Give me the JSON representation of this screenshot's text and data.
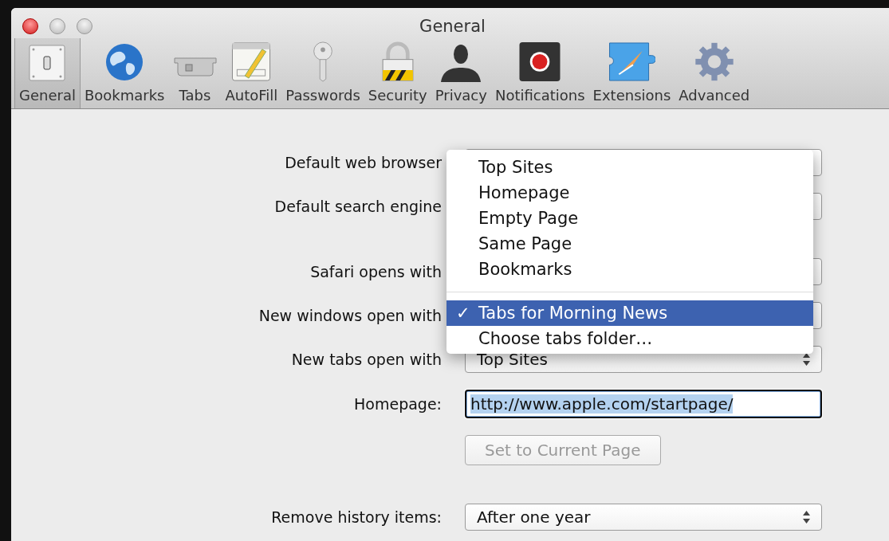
{
  "window": {
    "title": "General"
  },
  "toolbar": [
    {
      "label": "General",
      "selected": true
    },
    {
      "label": "Bookmarks",
      "selected": false
    },
    {
      "label": "Tabs",
      "selected": false
    },
    {
      "label": "AutoFill",
      "selected": false
    },
    {
      "label": "Passwords",
      "selected": false
    },
    {
      "label": "Security",
      "selected": false
    },
    {
      "label": "Privacy",
      "selected": false
    },
    {
      "label": "Notifications",
      "selected": false
    },
    {
      "label": "Extensions",
      "selected": false
    },
    {
      "label": "Advanced",
      "selected": false
    }
  ],
  "groups": [
    [
      {
        "kind": "popup",
        "label": "Default web browser"
      },
      {
        "kind": "popup",
        "label": "Default search engine"
      }
    ],
    [
      {
        "kind": "popup",
        "label": "Safari opens with"
      },
      {
        "kind": "popup",
        "label": "New windows open with"
      },
      {
        "kind": "popup",
        "label": "New tabs open with",
        "value": "Top Sites"
      },
      {
        "kind": "text",
        "label": "Homepage:",
        "value": "http://www.apple.com/startpage/"
      },
      {
        "kind": "button",
        "label": "Set to Current Page",
        "disabled": true
      }
    ],
    [
      {
        "kind": "popup",
        "label": "Remove history items:",
        "value": "After one year"
      }
    ]
  ],
  "menu": [
    {
      "kind": "item",
      "label": "Top Sites",
      "selected": false
    },
    {
      "kind": "item",
      "label": "Homepage",
      "selected": false
    },
    {
      "kind": "item",
      "label": "Empty Page",
      "selected": false
    },
    {
      "kind": "item",
      "label": "Same Page",
      "selected": false
    },
    {
      "kind": "item",
      "label": "Bookmarks",
      "selected": false
    },
    {
      "kind": "separator"
    },
    {
      "kind": "item",
      "label": "Tabs for Morning News",
      "selected": true,
      "check": "✓"
    },
    {
      "kind": "item",
      "label": "Choose tabs folder…",
      "selected": false
    }
  ]
}
